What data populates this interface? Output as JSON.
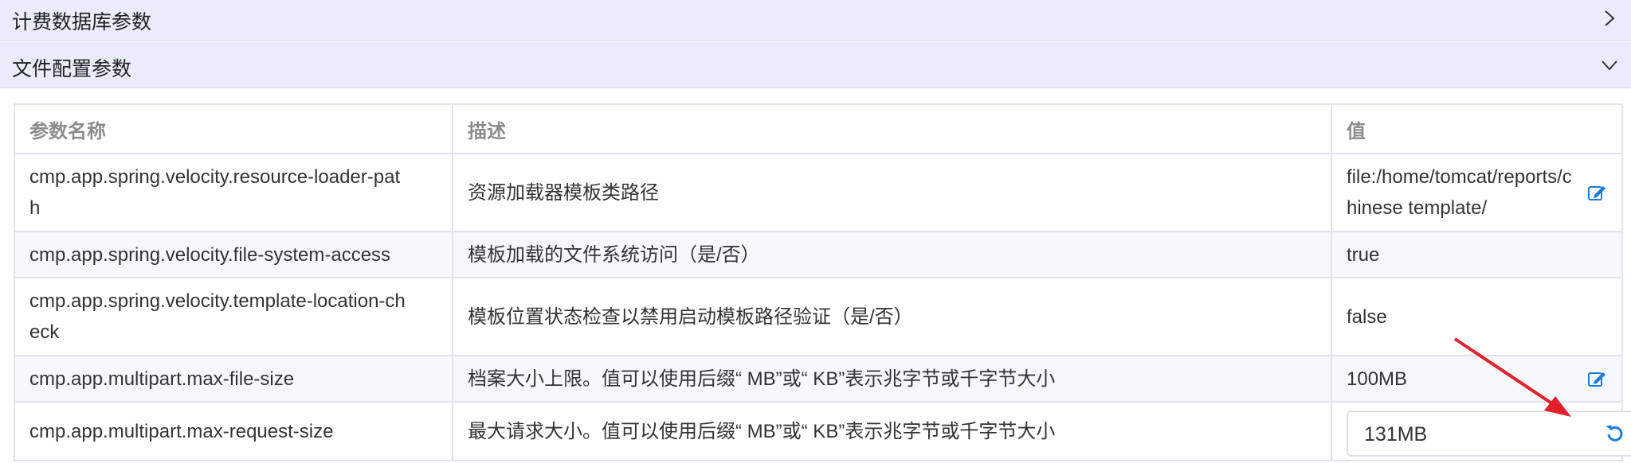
{
  "accordion": [
    {
      "title": "计费数据库参数",
      "state": "collapsed",
      "icon": "chevron-right-icon"
    },
    {
      "title": "文件配置参数",
      "state": "expanded",
      "icon": "chevron-down-icon"
    }
  ],
  "table": {
    "headers": [
      "参数名称",
      "描述",
      "值"
    ],
    "rows": [
      {
        "name": "cmp.app.spring.velocity.resource-loader-path",
        "desc": "资源加载器模板类路径",
        "value": "file:/home/tomcat/reports/chinese template/",
        "action": "edit-icon"
      },
      {
        "name": "cmp.app.spring.velocity.file-system-access",
        "desc": "模板加载的文件系统访问（是/否）",
        "value": "true"
      },
      {
        "name": "cmp.app.spring.velocity.template-location-check",
        "desc": "模板位置状态检查以禁用启动模板路径验证（是/否）",
        "value": "false"
      },
      {
        "name": "cmp.app.multipart.max-file-size",
        "desc": "档案大小上限。值可以使用后缀“ MB”或“ KB”表示兆字节或千字节大小",
        "value": "100MB",
        "action": "edit-icon"
      },
      {
        "name": "cmp.app.multipart.max-request-size",
        "desc": "最大请求大小。值可以使用后缀“ MB”或“ KB”表示兆字节或千字节大小",
        "value": "131MB",
        "action": "editing"
      }
    ]
  },
  "colors": {
    "accordion_bg": "#e9ecfb",
    "icon_blue": "#1a7ddb",
    "highlight_red": "#e0202a"
  }
}
